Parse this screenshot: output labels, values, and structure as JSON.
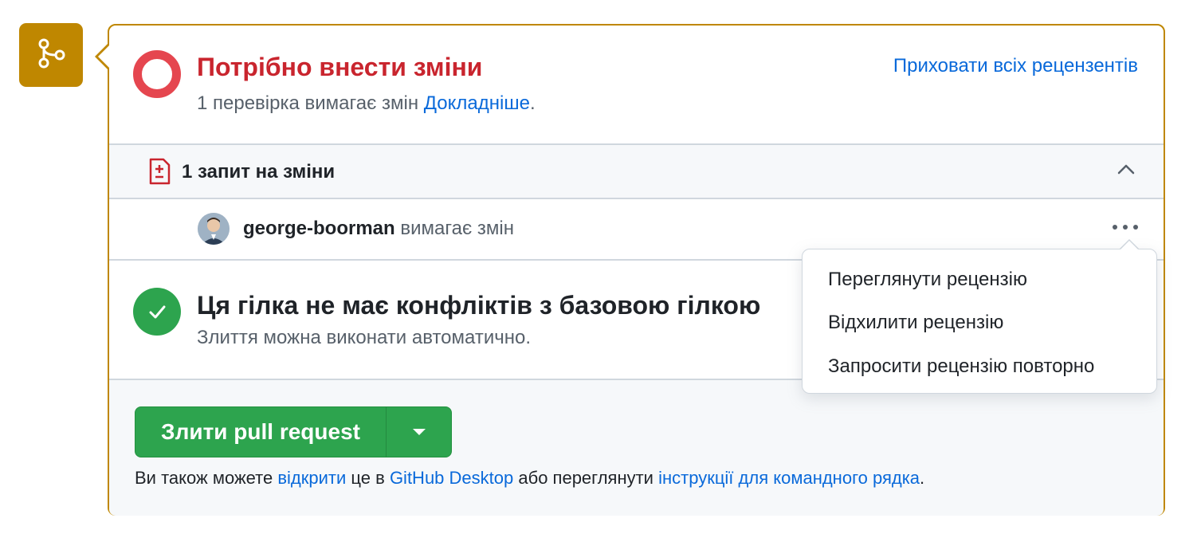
{
  "badge": {
    "icon": "git-merge-icon",
    "color": "#bf8700"
  },
  "status": {
    "icon": "changes-requested-icon",
    "title": "Потрібно внести зміни",
    "subtitle": "1 перевірка вимагає змін",
    "learn_more": "Докладніше",
    "period": ".",
    "hide_reviewers": "Приховати всіх рецензентів",
    "title_color": "#c9252e"
  },
  "requests": {
    "icon": "file-diff-icon",
    "label": "1 запит на зміни",
    "toggle_icon": "chevron-up-icon"
  },
  "reviewer": {
    "name": "george-boorman",
    "action": "вимагає змін",
    "more_icon": "kebab-horizontal-icon"
  },
  "conflicts": {
    "icon": "check-icon",
    "title": "Ця гілка не має конфліктів з базовою гілкою",
    "subtitle": "Злиття можна виконати автоматично."
  },
  "merge": {
    "button_label": "Злити pull request",
    "caret_icon": "triangle-down-icon",
    "button_color": "#2da44e",
    "alt_prefix": "Ви також можете",
    "alt_open": "відкрити",
    "alt_mid1": "це в",
    "alt_desktop": "GitHub Desktop",
    "alt_mid2": "або переглянути",
    "alt_instructions": "інструкції для командного рядка",
    "alt_suffix": "."
  },
  "menu": {
    "items": [
      "Переглянути рецензію",
      "Відхилити рецензію",
      "Запросити рецензію повторно"
    ]
  }
}
